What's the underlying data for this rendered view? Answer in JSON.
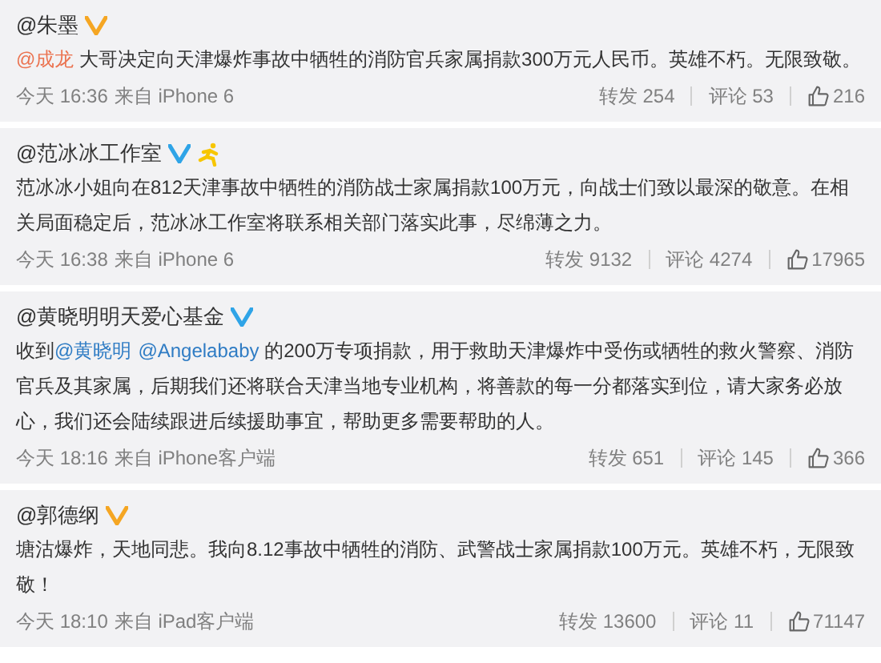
{
  "posts": [
    {
      "author": "@朱墨",
      "badge": {
        "kind": "personal"
      },
      "extra_badge": false,
      "body": [
        {
          "kind": "mention",
          "text": "@成龙",
          "color": "#eb7350"
        },
        {
          "kind": "text",
          "text": " 大哥决定向天津爆炸事故中牺牲的消防官兵家属捐款300万元人民币。英雄不朽。无限致敬。"
        }
      ],
      "time": "今天 16:36",
      "source": "来自 iPhone 6",
      "reposts": "转发 254",
      "comments": "评论 53",
      "likes": "216"
    },
    {
      "author": "@范冰冰工作室",
      "badge": {
        "kind": "org"
      },
      "extra_badge": true,
      "body": [
        {
          "kind": "text",
          "text": "范冰冰小姐向在812天津事故中牺牲的消防战士家属捐款100万元，向战士们致以最深的敬意。在相关局面稳定后，范冰冰工作室将联系相关部门落实此事，尽绵薄之力。"
        }
      ],
      "time": "今天 16:38",
      "source": "来自 iPhone 6",
      "reposts": "转发 9132",
      "comments": "评论 4274",
      "likes": "17965"
    },
    {
      "author": "@黄晓明明天爱心基金",
      "badge": {
        "kind": "org"
      },
      "extra_badge": false,
      "body": [
        {
          "kind": "text",
          "text": "收到"
        },
        {
          "kind": "mention",
          "text": "@黄晓明",
          "color": "#2f7cc4"
        },
        {
          "kind": "mention",
          "text": "@Angelababy",
          "color": "#2f7cc4"
        },
        {
          "kind": "text",
          "text": " 的200万专项捐款，用于救助天津爆炸中受伤或牺牲的救火警察、消防官兵及其家属，后期我们还将联合天津当地专业机构，将善款的每一分都落实到位，请大家务必放心，我们还会陆续跟进后续援助事宜，帮助更多需要帮助的人。"
        }
      ],
      "time": "今天 18:16",
      "source": "来自 iPhone客户端",
      "reposts": "转发 651",
      "comments": "评论 145",
      "likes": "366"
    },
    {
      "author": "@郭德纲",
      "badge": {
        "kind": "personal"
      },
      "extra_badge": false,
      "body": [
        {
          "kind": "text",
          "text": "塘沽爆炸，天地同悲。我向8.12事故中牺牲的消防、武警战士家属捐款100万元。英雄不朽，无限致敬！"
        }
      ],
      "time": "今天 18:10",
      "source": "来自 iPad客户端",
      "reposts": "转发 13600",
      "comments": "评论 11",
      "likes": "71147"
    }
  ]
}
